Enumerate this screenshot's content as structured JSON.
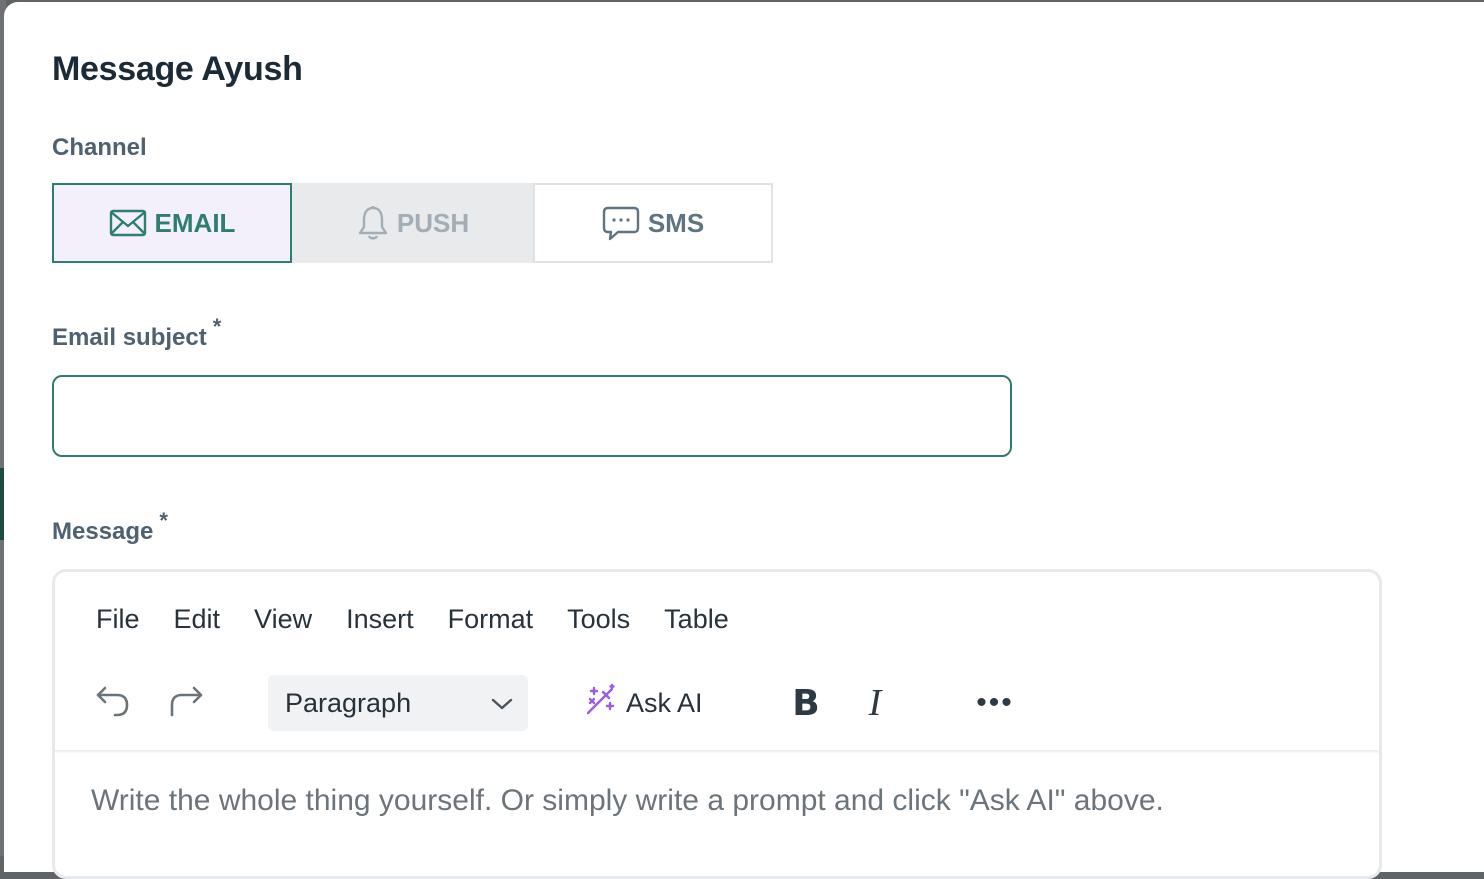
{
  "dialog": {
    "title": "Message Ayush"
  },
  "channel": {
    "label": "Channel",
    "options": [
      {
        "label": "EMAIL",
        "icon": "envelope-icon",
        "selected": true
      },
      {
        "label": "PUSH",
        "icon": "bell-icon",
        "selected": false,
        "disabled": true
      },
      {
        "label": "SMS",
        "icon": "chat-bubble-icon",
        "selected": false
      }
    ]
  },
  "subject": {
    "label": "Email subject",
    "required_mark": "*",
    "value": "",
    "placeholder": ""
  },
  "message": {
    "label": "Message",
    "required_mark": "*"
  },
  "editor": {
    "menu": [
      "File",
      "Edit",
      "View",
      "Insert",
      "Format",
      "Tools",
      "Table"
    ],
    "block_format": "Paragraph",
    "ask_ai_label": "Ask AI",
    "bold_label": "B",
    "italic_label": "I",
    "more_label": "•••",
    "placeholder": "Write the whole thing yourself. Or simply write a prompt and click \"Ask AI\" above."
  },
  "colors": {
    "accent": "#2e7d71",
    "selected_bg": "#f4f0fb",
    "ai_purple": "#9b5de5",
    "heading": "#1c2a36",
    "label": "#4f6171"
  }
}
